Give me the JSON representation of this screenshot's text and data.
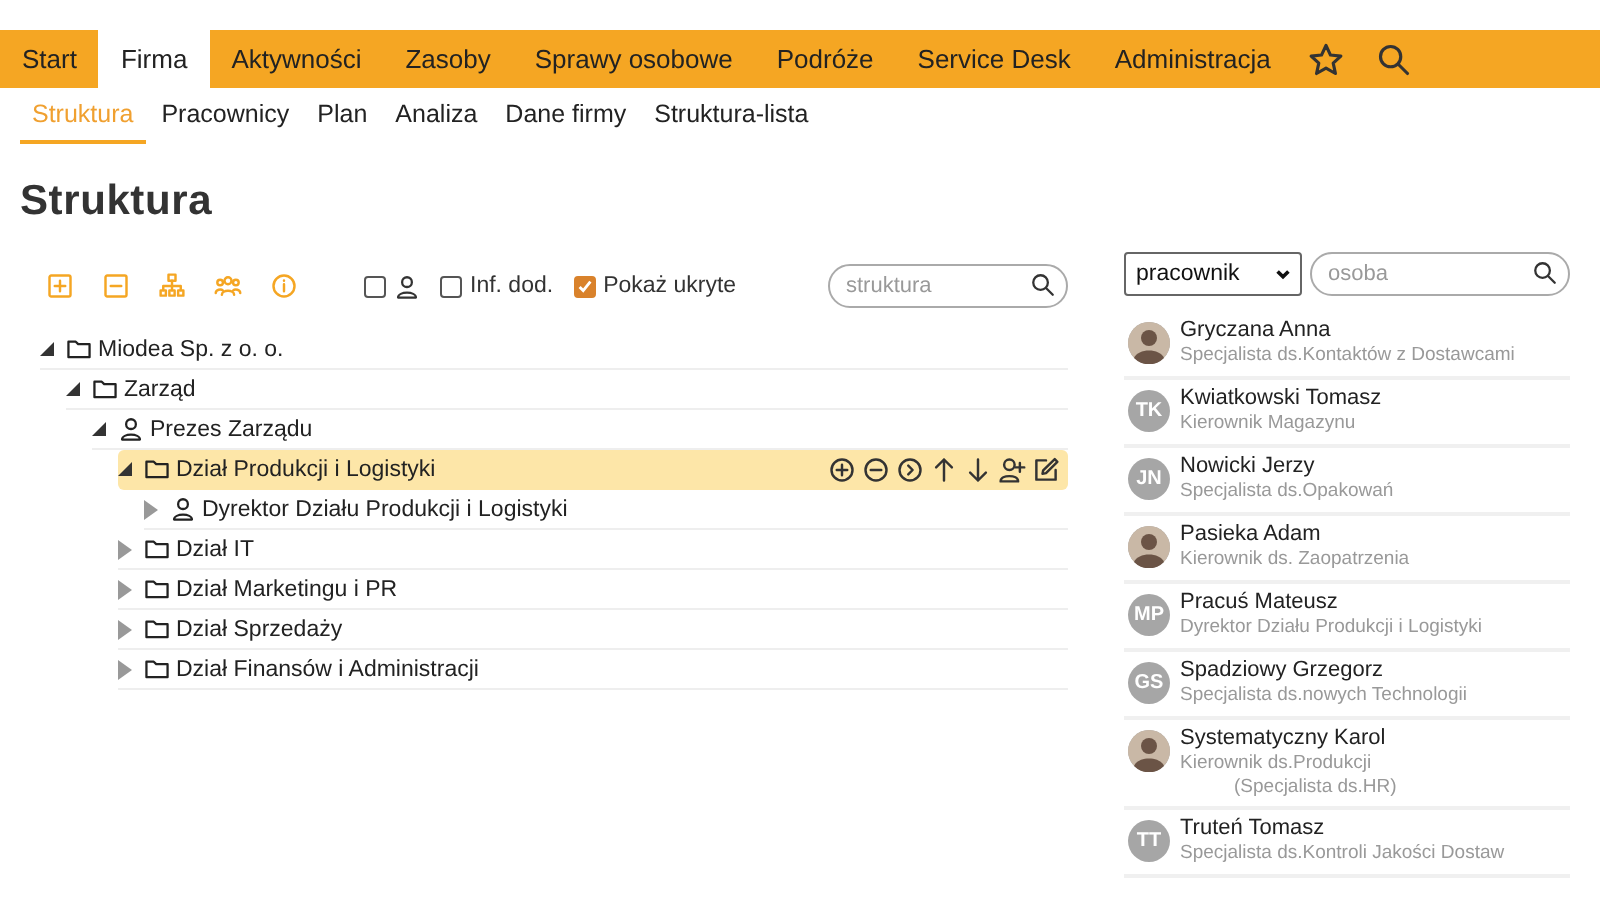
{
  "menu": [
    {
      "label": "Start",
      "selected": false
    },
    {
      "label": "Firma",
      "selected": true
    },
    {
      "label": "Aktywności",
      "selected": false
    },
    {
      "label": "Zasoby",
      "selected": false
    },
    {
      "label": "Sprawy osobowe",
      "selected": false
    },
    {
      "label": "Podróże",
      "selected": false
    },
    {
      "label": "Service Desk",
      "selected": false
    },
    {
      "label": "Administracja",
      "selected": false
    }
  ],
  "subtabs": [
    {
      "label": "Struktura",
      "selected": true
    },
    {
      "label": "Pracownicy",
      "selected": false
    },
    {
      "label": "Plan",
      "selected": false
    },
    {
      "label": "Analiza",
      "selected": false
    },
    {
      "label": "Dane firmy",
      "selected": false
    },
    {
      "label": "Struktura-lista",
      "selected": false
    }
  ],
  "page_title": "Struktura",
  "options": [
    {
      "kind": "person",
      "checked": false
    },
    {
      "kind": "text",
      "label": "Inf. dod.",
      "checked": false
    },
    {
      "kind": "text",
      "label": "Pokaż ukryte",
      "checked": true
    }
  ],
  "tree_search": {
    "placeholder": "struktura"
  },
  "tree": [
    {
      "label": "Miodea Sp. z o. o.",
      "kind": "folder",
      "expanded": true,
      "selected": false,
      "children": [
        {
          "label": "Zarząd",
          "kind": "folder",
          "expanded": true,
          "selected": false,
          "children": [
            {
              "label": "Prezes Zarządu",
              "kind": "person",
              "expanded": true,
              "selected": false,
              "children": [
                {
                  "label": "Dział Produkcji i Logistyki",
                  "kind": "folder",
                  "expanded": true,
                  "selected": true,
                  "children": [
                    {
                      "label": "Dyrektor Działu Produkcji i Logistyki",
                      "kind": "person",
                      "expanded": false,
                      "selected": false
                    }
                  ]
                },
                {
                  "label": "Dział IT",
                  "kind": "folder",
                  "expanded": false,
                  "selected": false
                },
                {
                  "label": "Dział Marketingu i PR",
                  "kind": "folder",
                  "expanded": false,
                  "selected": false
                },
                {
                  "label": "Dział Sprzedaży",
                  "kind": "folder",
                  "expanded": false,
                  "selected": false
                },
                {
                  "label": "Dział Finansów i Administracji",
                  "kind": "folder",
                  "expanded": false,
                  "selected": false
                }
              ]
            }
          ]
        }
      ]
    }
  ],
  "people_filter": {
    "value": "pracownik"
  },
  "people_search": {
    "placeholder": "osoba"
  },
  "people": [
    {
      "name": "Gryczana Anna",
      "role": "Specjalista ds.Kontaktów z Dostawcami",
      "avatar": {
        "kind": "photo"
      }
    },
    {
      "name": "Kwiatkowski Tomasz",
      "role": "Kierownik Magazynu",
      "avatar": {
        "kind": "initials",
        "text": "TK"
      }
    },
    {
      "name": "Nowicki Jerzy",
      "role": "Specjalista ds.Opakowań",
      "avatar": {
        "kind": "initials",
        "text": "JN"
      }
    },
    {
      "name": "Pasieka Adam",
      "role": "Kierownik ds. Zaopatrzenia",
      "avatar": {
        "kind": "photo"
      }
    },
    {
      "name": "Pracuś Mateusz",
      "role": "Dyrektor Działu Produkcji i Logistyki",
      "avatar": {
        "kind": "initials",
        "text": "MP"
      }
    },
    {
      "name": "Spadziowy Grzegorz",
      "role": "Specjalista ds.nowych Technologii",
      "avatar": {
        "kind": "initials",
        "text": "GS"
      }
    },
    {
      "name": "Systematyczny Karol",
      "role": "Kierownik ds.Produkcji",
      "extra": "(Specjalista ds.HR)",
      "avatar": {
        "kind": "photo"
      }
    },
    {
      "name": "Truteń Tomasz",
      "role": "Specjalista ds.Kontroli Jakości Dostaw",
      "avatar": {
        "kind": "initials",
        "text": "TT"
      }
    }
  ]
}
